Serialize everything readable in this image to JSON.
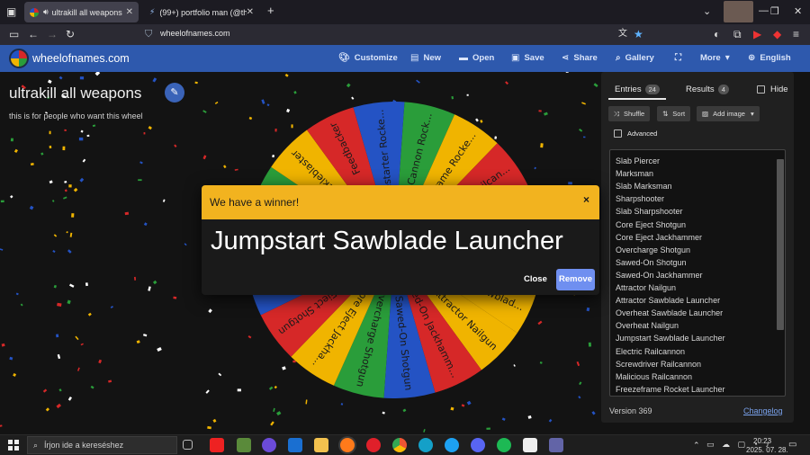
{
  "browser": {
    "tabs": [
      {
        "title": "ultrakill all weapons",
        "active": true
      },
      {
        "title": "(99+) portfolio man (@the-real",
        "active": false
      }
    ],
    "new_tab": "+",
    "url": "wheelofnames.com"
  },
  "site": {
    "name": "wheelofnames.com",
    "menu": [
      {
        "label": "Customize",
        "icon": "palette-icon"
      },
      {
        "label": "New",
        "icon": "file-icon"
      },
      {
        "label": "Open",
        "icon": "folder-icon"
      },
      {
        "label": "Save",
        "icon": "save-icon"
      },
      {
        "label": "Share",
        "icon": "share-icon"
      },
      {
        "label": "Gallery",
        "icon": "search-icon"
      },
      {
        "label": "",
        "icon": "fullscreen-icon"
      },
      {
        "label": "More",
        "icon": "chevron-down-icon"
      },
      {
        "label": "English",
        "icon": "globe-icon"
      }
    ],
    "accent": "#2e59ad"
  },
  "wheel": {
    "title": "ultrakill all weapons",
    "description": "this is for people who want this wheel",
    "colors": [
      "#2a9d3a",
      "#d62828",
      "#f0b400",
      "#2453c4"
    ],
    "visible_slices": [
      {
        "label": "Whiplash",
        "color": "#2a9d3a"
      },
      {
        "label": "Knuckleblaster",
        "color": "#f0b400"
      },
      {
        "label": "Feedbacker",
        "color": "#d62828"
      },
      {
        "label": "Firestarter Rocke...",
        "color": "#2453c4"
      },
      {
        "label": "SRS Cannon Rock...",
        "color": "#2a9d3a"
      },
      {
        "label": "Freezeframe Rocke...",
        "color": "#f0b400"
      },
      {
        "label": "Malicious Railcan...",
        "color": "#d62828"
      },
      {
        "label": "Screwdriver Railc...",
        "color": "#2453c4"
      },
      {
        "label": "Attractor Sawblad...",
        "color": "#2453c4"
      },
      {
        "label": "Attractor Sawblad...",
        "color": "#f0b400"
      },
      {
        "label": "Attractor Nailgun",
        "color": "#f0b400"
      },
      {
        "label": "Sawed-On Jackhamm...",
        "color": "#d62828"
      },
      {
        "label": "Sawed-On Shotgun",
        "color": "#2453c4"
      },
      {
        "label": "Overcharge Shotgun",
        "color": "#2a9d3a"
      },
      {
        "label": "Core Eject Jackha...",
        "color": "#f0b400"
      },
      {
        "label": "Core Eject Shotgun",
        "color": "#d62828"
      },
      {
        "label": "Slab Sharpshooter",
        "color": "#2453c4"
      },
      {
        "label": "Slab Sharpshoo...",
        "color": "#2a9d3a"
      }
    ]
  },
  "panel": {
    "tabs": [
      {
        "label": "Entries",
        "count": "24"
      },
      {
        "label": "Results",
        "count": "4"
      }
    ],
    "hide_label": "Hide",
    "tools": [
      {
        "label": "Shuffle",
        "icon": "shuffle-icon"
      },
      {
        "label": "Sort",
        "icon": "sort-icon"
      },
      {
        "label": "Add image",
        "icon": "image-icon"
      }
    ],
    "advanced_label": "Advanced",
    "entries": [
      "Slab Piercer",
      "Marksman",
      "Slab Marksman",
      "Sharpshooter",
      "Slab Sharpshooter",
      "Core Eject Shotgun",
      "Core Eject Jackhammer",
      "Overcharge Shotgun",
      "Sawed-On Shotgun",
      "Sawed-On Jackhammer",
      "Attractor Nailgun",
      "Attractor Sawblade Launcher",
      "Overheat Sawblade Launcher",
      "Overheat Nailgun",
      "Jumpstart Sawblade Launcher",
      "Electric Railcannon",
      "Screwdriver Railcannon",
      "Malicious Railcannon",
      "Freezeframe Rocket Launcher"
    ],
    "version": "Version 369",
    "changelog": "Changelog"
  },
  "modal": {
    "title": "We have a winner!",
    "close_x": "×",
    "winner": "Jumpstart Sawblade Launcher",
    "close_label": "Close",
    "remove_label": "Remove",
    "header_color": "#f2b31f"
  },
  "taskbar": {
    "search_placeholder": "Írjon ide a kereséshez",
    "time": "20:23",
    "date": "2025. 07. 28."
  }
}
